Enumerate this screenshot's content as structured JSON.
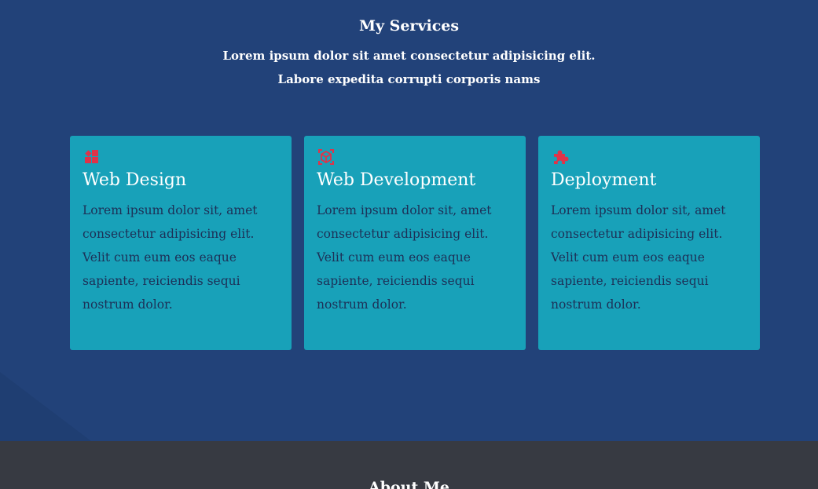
{
  "services": {
    "title": "My Services",
    "subtitle_line1": "Lorem ipsum dolor sit amet consectetur adipisicing elit.",
    "subtitle_line2": "Labore expedita corrupti corporis nams",
    "cards": [
      {
        "icon": "grid-blocks-icon",
        "title": "Web Design",
        "text": "Lorem ipsum dolor sit, amet consectetur adipisicing elit. Velit cum eum eos eaque sapiente, reiciendis sequi nostrum dolor."
      },
      {
        "icon": "cube-icon",
        "title": "Web Development",
        "text": "Lorem ipsum dolor sit, amet consectetur adipisicing elit. Velit cum eum eos eaque sapiente, reiciendis sequi nostrum dolor."
      },
      {
        "icon": "puzzle-piece-icon",
        "title": "Deployment",
        "text": "Lorem ipsum dolor sit, amet consectetur adipisicing elit. Velit cum eum eos eaque sapiente, reiciendis sequi nostrum dolor."
      }
    ]
  },
  "about": {
    "title": "About Me"
  },
  "colors": {
    "services_bg": "#224279",
    "card_bg": "#18a1b9",
    "icon_accent": "#e03349",
    "about_bg": "#373a42"
  }
}
